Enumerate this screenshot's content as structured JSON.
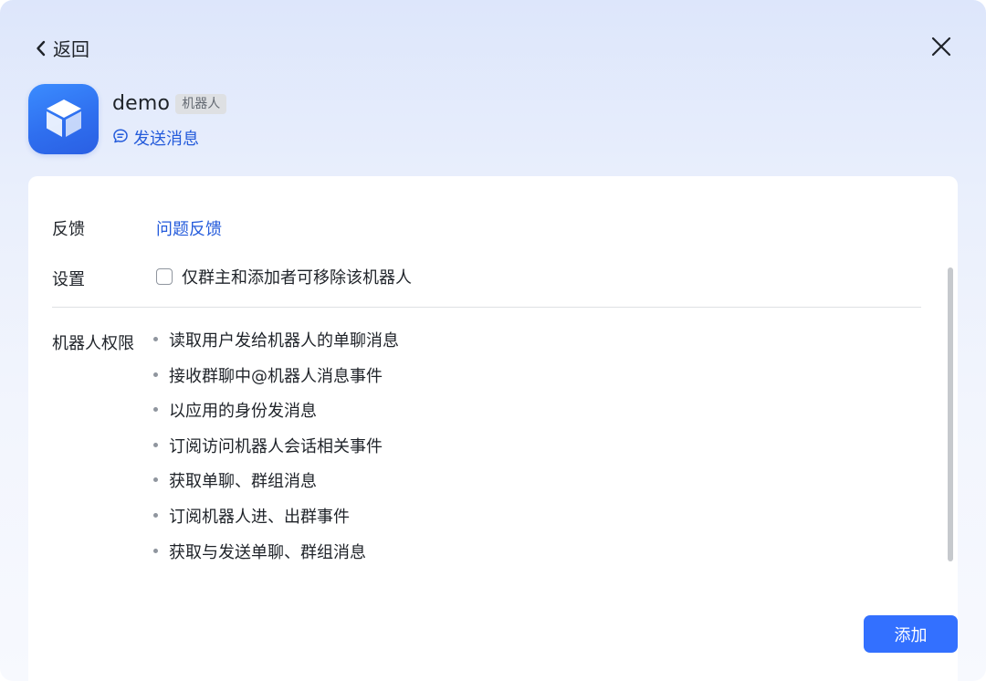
{
  "header": {
    "back_label": "返回",
    "back_icon": "chevron-left-icon",
    "close_icon": "close-icon"
  },
  "bot": {
    "icon": "cube-icon",
    "name": "demo",
    "badge": "机器人",
    "send_message_label": "发送消息",
    "send_message_icon": "chat-bubble-icon"
  },
  "details": {
    "feedback": {
      "label": "反馈",
      "link_text": "问题反馈"
    },
    "settings": {
      "label": "设置",
      "checkbox_label": "仅群主和添加者可移除该机器人",
      "checked": false
    },
    "permissions": {
      "label": "机器人权限",
      "items": [
        "读取用户发给机器人的单聊消息",
        "接收群聊中@机器人消息事件",
        "以应用的身份发消息",
        "订阅访问机器人会话相关事件",
        "获取单聊、群组消息",
        "订阅机器人进、出群事件",
        "获取与发送单聊、群组消息"
      ]
    }
  },
  "footer": {
    "add_button_label": "添加"
  },
  "colors": {
    "accent": "#3370ff",
    "link": "#245bdb",
    "text": "#1f2329",
    "muted": "#646a73"
  }
}
